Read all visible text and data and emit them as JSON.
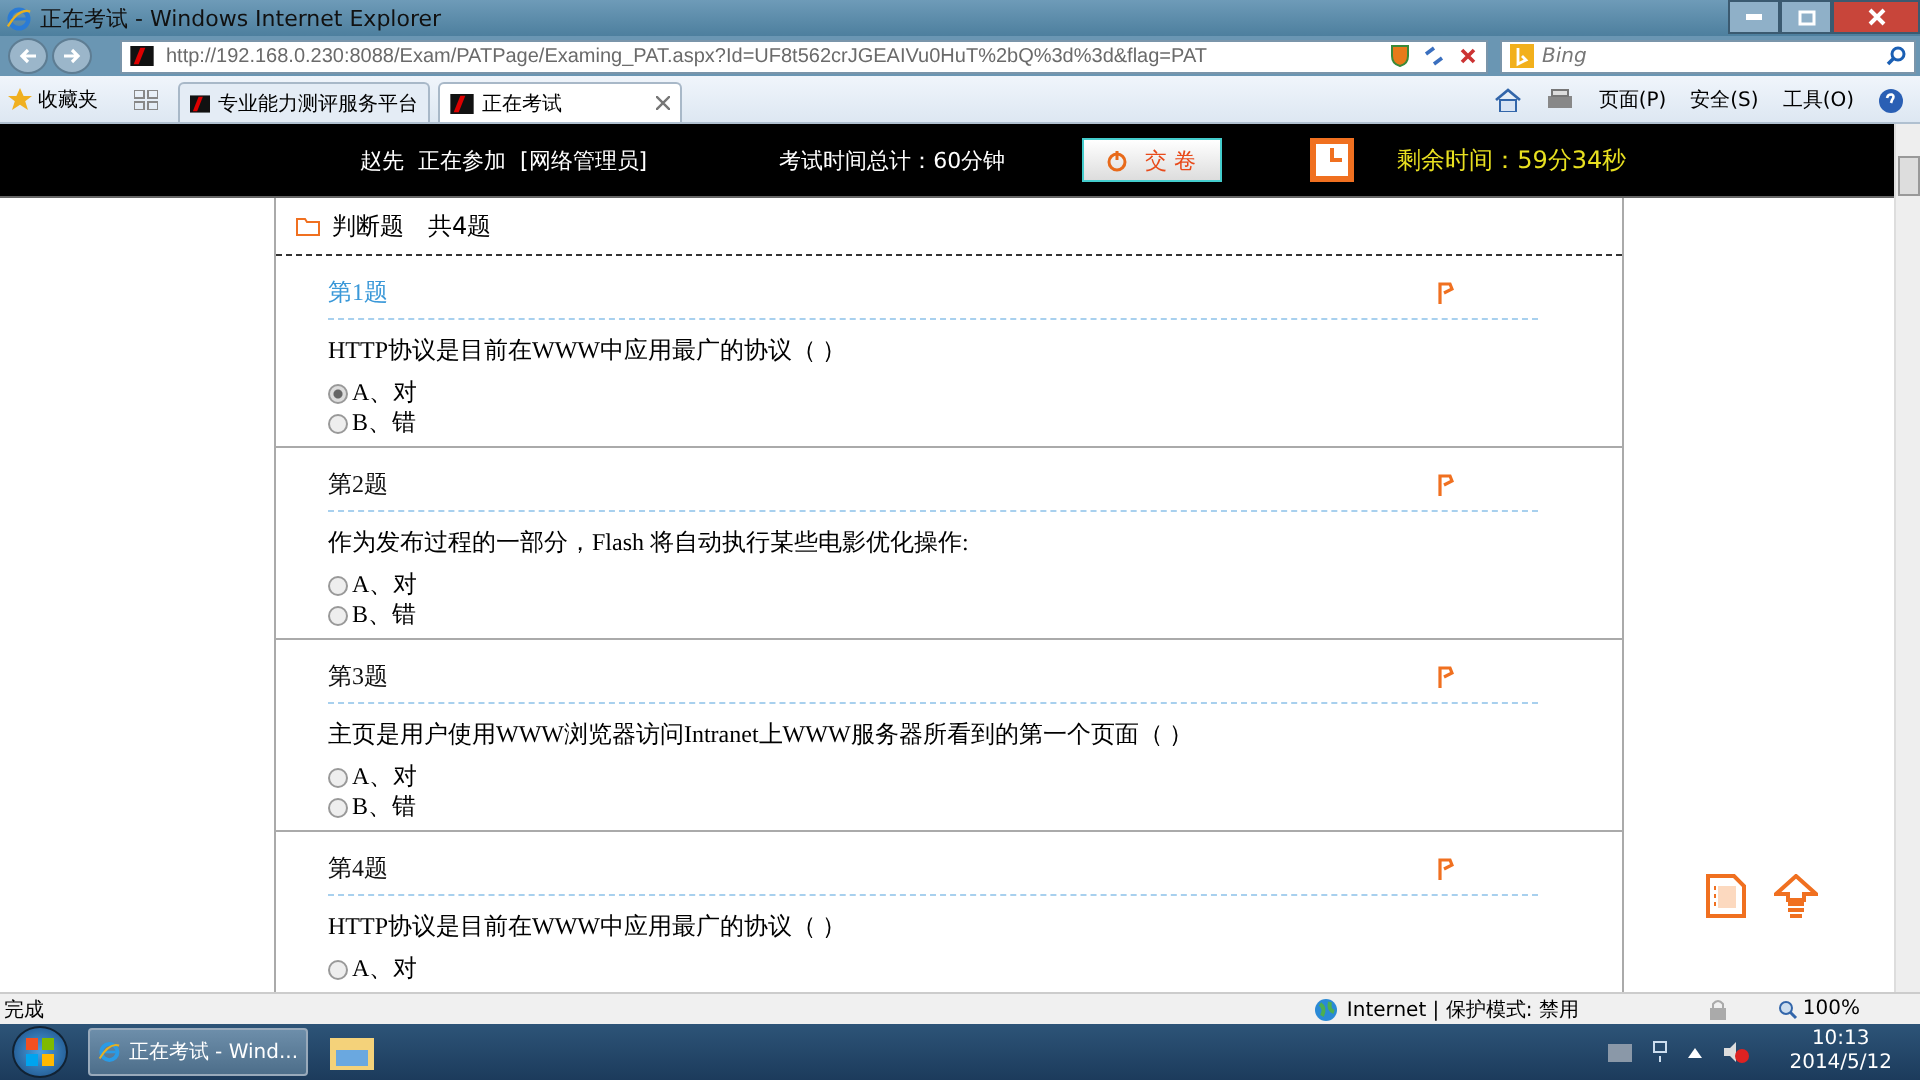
{
  "window": {
    "title": "正在考试 - Windows Internet Explorer"
  },
  "address_bar": {
    "url": "http://192.168.0.230:8088/Exam/PATPage/Examing_PAT.aspx?Id=UF8t562crJGEAIVu0HuT%2bQ%3d%3d&flag=PAT",
    "search_placeholder": "Bing"
  },
  "favorites": "收藏夹",
  "tabs": [
    {
      "label": "专业能力测评服务平台",
      "selected": false
    },
    {
      "label": "正在考试",
      "selected": true
    }
  ],
  "command_bar": [
    "页面(P)",
    "安全(S)",
    "工具(O)"
  ],
  "header": {
    "user": "赵先  正在参加  [网络管理员]",
    "total_time": "考试时间总计：60分钟",
    "submit": "交 卷",
    "remaining": "剩余时间：59分34秒"
  },
  "section": {
    "title": "判断题",
    "count": "共4题"
  },
  "questions": [
    {
      "number": "第1题",
      "current": true,
      "text": "HTTP协议是目前在WWW中应用最广的协议（  ）",
      "options": [
        {
          "label": "A、对",
          "selected": true
        },
        {
          "label": "B、错",
          "selected": false
        }
      ]
    },
    {
      "number": "第2题",
      "current": false,
      "text": "作为发布过程的一部分，Flash 将自动执行某些电影优化操作:",
      "options": [
        {
          "label": "A、对",
          "selected": false
        },
        {
          "label": "B、错",
          "selected": false
        }
      ]
    },
    {
      "number": "第3题",
      "current": false,
      "text": "主页是用户使用WWW浏览器访问Intranet上WWW服务器所看到的第一个页面（  ）",
      "options": [
        {
          "label": "A、对",
          "selected": false
        },
        {
          "label": "B、错",
          "selected": false
        }
      ]
    },
    {
      "number": "第4题",
      "current": false,
      "text": "HTTP协议是目前在WWW中应用最广的协议（  ）",
      "options": [
        {
          "label": "A、对",
          "selected": false
        }
      ]
    }
  ],
  "status_bar": {
    "text": "完成",
    "zone": "Internet | 保护模式: 禁用",
    "zoom": "100%"
  },
  "taskbar": {
    "window": "正在考试 - Wind...",
    "time": "10:13",
    "date": "2014/5/12"
  }
}
